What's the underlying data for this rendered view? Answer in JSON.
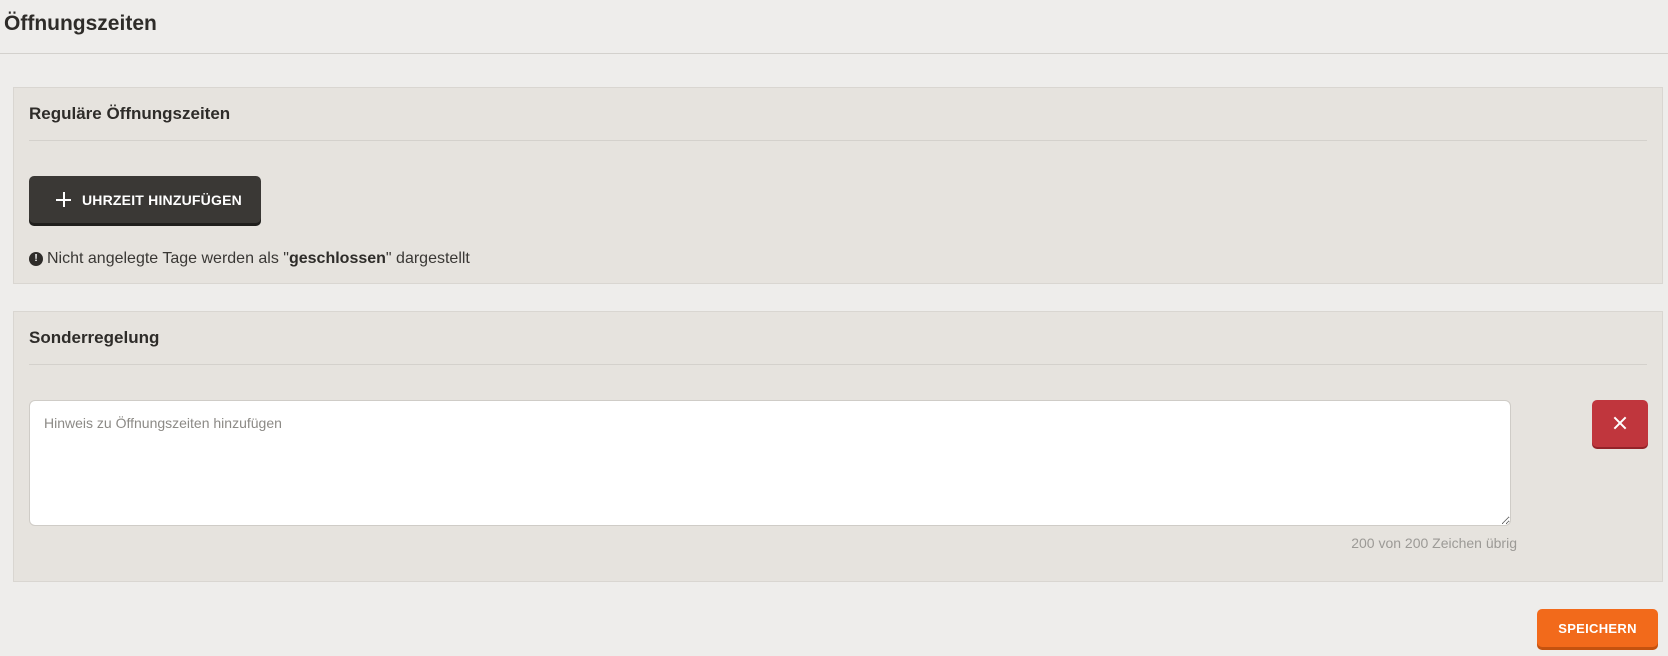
{
  "page": {
    "title": "Öffnungszeiten"
  },
  "regular": {
    "title": "Reguläre Öffnungszeiten",
    "add_button_label": "UHRZEIT HINZUFÜGEN",
    "add_button_icon": "plus-icon",
    "info_icon": "exclamation-circle-icon",
    "info_prefix": "Nicht angelegte Tage werden als \"",
    "info_bold": "geschlossen",
    "info_suffix": "\" dargestellt"
  },
  "special": {
    "title": "Sonderregelung",
    "textarea_value": "",
    "textarea_placeholder": "Hinweis zu Öffnungszeiten hinzufügen",
    "counter_text": "200 von 200 Zeichen übrig",
    "delete_icon": "close-icon"
  },
  "footer": {
    "save_label": "SPEICHERN"
  },
  "colors": {
    "background": "#eeedeb",
    "panel": "#e6e3de",
    "dark_button": "#3a3835",
    "delete_button": "#c0363d",
    "save_button": "#f26a1b"
  }
}
